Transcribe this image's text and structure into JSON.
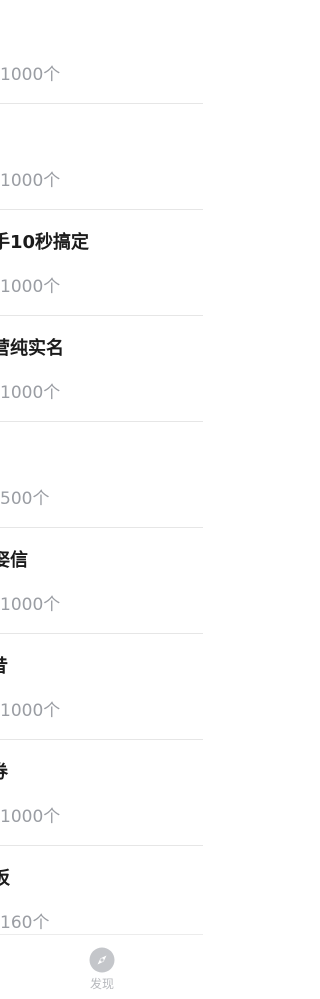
{
  "items": [
    {
      "title": "",
      "count": "1000个"
    },
    {
      "title": "",
      "count": "1000个"
    },
    {
      "title": "手10秒搞定",
      "count": "1000个"
    },
    {
      "title": "营纯实名",
      "count": "1000个"
    },
    {
      "title": "",
      "count": "500个"
    },
    {
      "title": "娶信",
      "count": "1000个"
    },
    {
      "title": "昔",
      "count": "1000个"
    },
    {
      "title": "券",
      "count": "1000个"
    },
    {
      "title": "扳",
      "count": "160个"
    }
  ],
  "tabbar": {
    "discover_label": "发现",
    "discover_icon": "compass-icon"
  },
  "colors": {
    "count_text": "#9a9da3",
    "title_text": "#1b1b1b",
    "divider": "#e6e6e6",
    "tab_inactive": "#b7b9bd"
  }
}
